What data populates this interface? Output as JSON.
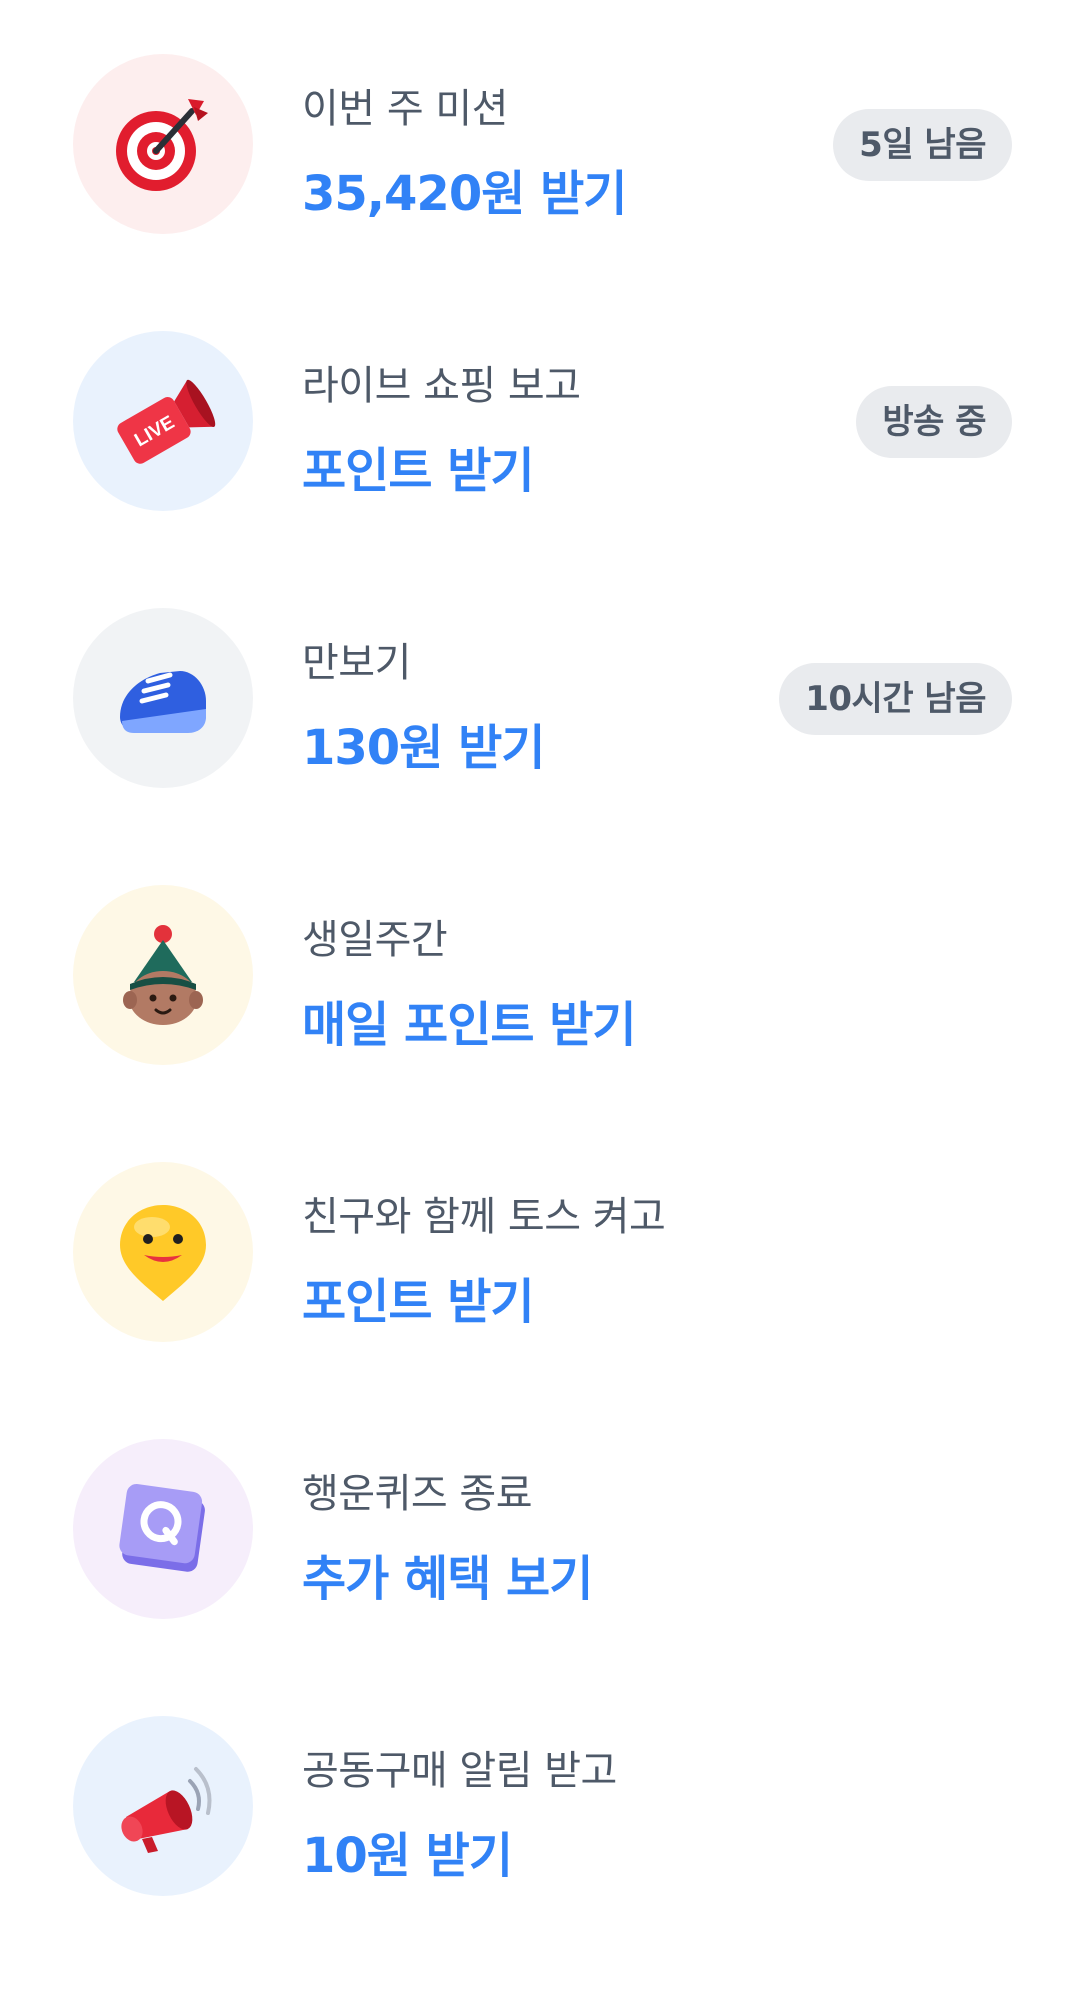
{
  "missions": [
    {
      "title": "이번 주 미션",
      "action": "35,420원 받기",
      "badge": "5일 남음",
      "icon": "target-dart-icon",
      "bg": "#fdeeee"
    },
    {
      "title": "라이브 쇼핑 보고",
      "action": "포인트 받기",
      "badge": "방송 중",
      "icon": "live-camera-icon",
      "bg": "#e9f2fd"
    },
    {
      "title": "만보기",
      "action": "130원 받기",
      "badge": "10시간 남음",
      "icon": "sneaker-icon",
      "bg": "#f1f3f5"
    },
    {
      "title": "생일주간",
      "action": "매일 포인트 받기",
      "badge": "",
      "icon": "party-hat-face-icon",
      "bg": "#fef8e6"
    },
    {
      "title": "친구와 함께 토스 켜고",
      "action": "포인트 받기",
      "badge": "",
      "icon": "smiley-pin-icon",
      "bg": "#fef8e6"
    },
    {
      "title": "행운퀴즈 종료",
      "action": "추가 혜택 보기",
      "badge": "",
      "icon": "quiz-block-icon",
      "bg": "#f6eefb"
    },
    {
      "title": "공동구매 알림 받고",
      "action": "10원 받기",
      "badge": "",
      "icon": "megaphone-icon",
      "bg": "#e9f2fd"
    }
  ]
}
